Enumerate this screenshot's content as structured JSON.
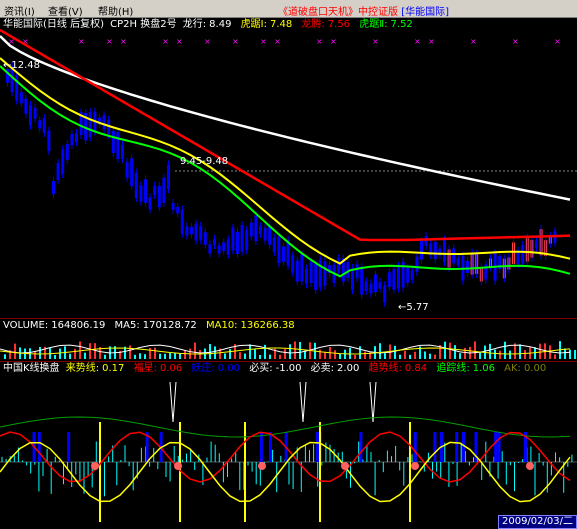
{
  "menubar": {
    "items": [
      {
        "label": "资讯(I)"
      },
      {
        "label": "查看(V)"
      },
      {
        "label": "帮助(H)"
      }
    ],
    "title_main": "《道破盘口天机》中控证版",
    "title_brand": "[华能国际]"
  },
  "main_chart": {
    "header": {
      "name": "华能国际(日线 后复权)",
      "indicator": "CP2H 换盘2号",
      "longxing_label": "龙行:",
      "longxing_value": "8.49",
      "hujue1_label": "虎踞Ⅰ:",
      "hujue1_value": "7.48",
      "longteng_label": "龙腾:",
      "longteng_value": "7.56",
      "hujue2_label": "虎踞Ⅱ:",
      "hujue2_value": "7.52"
    },
    "annotations": {
      "high_left": "←12.48",
      "mid_label": "9.45-9.48",
      "low_label": "←5.77"
    },
    "colors": {
      "white_line": "#ffffff",
      "red_line": "#ff0000",
      "yellow_line": "#ffff00",
      "green_line": "#00ff00",
      "candles": "#0000ff",
      "markers": "#ff00ff"
    }
  },
  "volume_panel": {
    "volume_label": "VOLUME:",
    "volume_value": "164806.19",
    "ma5_label": "MA5:",
    "ma5_value": "170128.72",
    "ma10_label": "MA10:",
    "ma10_value": "136266.38"
  },
  "indicator_panel": {
    "name": "中国K线换盘",
    "laishi_label": "来势线:",
    "laishi_value": "0.17",
    "fuxing_label": "福星:",
    "fuxing_value": "0.06",
    "yaozhuang_label": "妖庄:",
    "yaozhuang_value": "0.00",
    "bimai_label": "必买:",
    "bimai_value": "-1.00",
    "bimai2_label": "必卖:",
    "bimai2_value": "2.00",
    "qushi_label": "趋势线:",
    "qushi_value": "0.84",
    "zhuizong_label": "追踪线:",
    "zhuizong_value": "1.06",
    "ak_label": "AK:",
    "ak_value": "0.00",
    "date": "2009/02/03/二"
  }
}
